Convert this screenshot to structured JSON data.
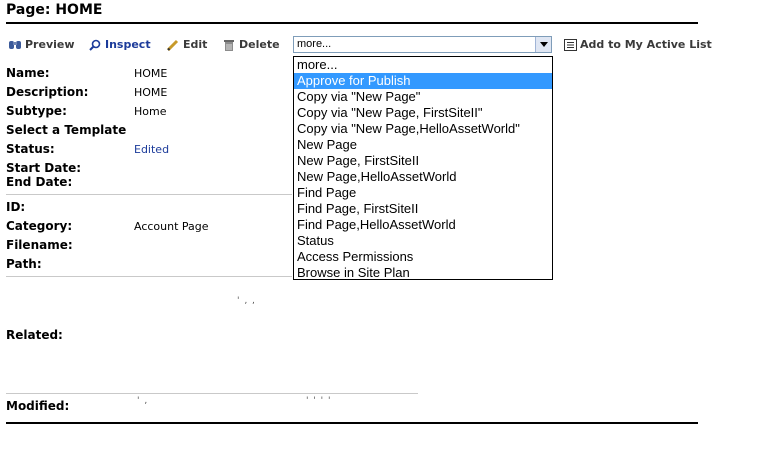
{
  "page": {
    "title": "Page: HOME"
  },
  "toolbar": {
    "preview": "Preview",
    "inspect": "Inspect",
    "edit": "Edit",
    "delete": "Delete",
    "action_select_value": "more...",
    "add_to_active_list": "Add to My Active List"
  },
  "fields": {
    "name": {
      "label": "Name:",
      "value": "HOME"
    },
    "description": {
      "label": "Description:",
      "value": "HOME"
    },
    "subtype": {
      "label": "Subtype:",
      "value": "Home"
    },
    "template": {
      "label": "Select a Template"
    },
    "status": {
      "label": "Status:",
      "value": "Edited"
    },
    "start_date": {
      "label": "Start Date:"
    },
    "end_date": {
      "label": "End Date:"
    },
    "id": {
      "label": "ID:"
    },
    "category": {
      "label": "Category:",
      "value": "Account Page"
    },
    "filename": {
      "label": "Filename:"
    },
    "path": {
      "label": "Path:"
    },
    "related": {
      "label": "Related:"
    },
    "modified": {
      "label": "Modified:"
    }
  },
  "dropdown": {
    "selected_index": 1,
    "options": [
      "more...",
      "Approve for Publish",
      "Copy via \"New Page\"",
      "Copy via \"New Page, FirstSiteII\"",
      "Copy via \"New Page,HelloAssetWorld\"",
      "New Page",
      "New Page, FirstSiteII",
      "New Page,HelloAssetWorld",
      "Find Page",
      "Find Page, FirstSiteII",
      "Find Page,HelloAssetWorld",
      "Status",
      "Access Permissions",
      "Browse in Site Plan"
    ]
  }
}
